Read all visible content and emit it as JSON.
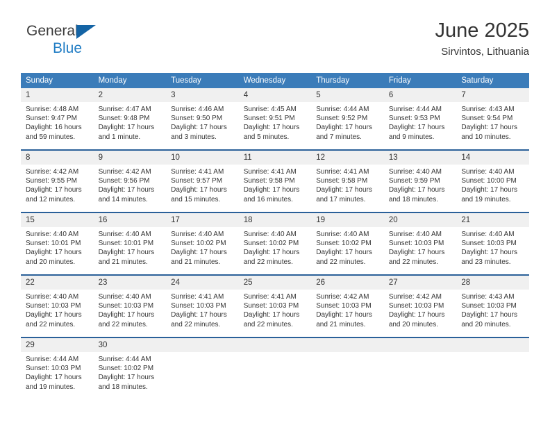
{
  "brand": {
    "name_top": "General",
    "name_bottom": "Blue",
    "triangle_color": "#1464a5",
    "blue_text_color": "#1f7cc4"
  },
  "header": {
    "title": "June 2025",
    "subtitle": "Sirvintos, Lithuania"
  },
  "theme": {
    "header_bg": "#3b7cb9",
    "week_divider": "#2a6099",
    "daynum_bg": "#f0f0f0",
    "text": "#333333"
  },
  "weekdays": [
    "Sunday",
    "Monday",
    "Tuesday",
    "Wednesday",
    "Thursday",
    "Friday",
    "Saturday"
  ],
  "weeks": [
    {
      "days": [
        {
          "num": "1",
          "sunrise": "Sunrise: 4:48 AM",
          "sunset": "Sunset: 9:47 PM",
          "daylight_1": "Daylight: 16 hours",
          "daylight_2": "and 59 minutes."
        },
        {
          "num": "2",
          "sunrise": "Sunrise: 4:47 AM",
          "sunset": "Sunset: 9:48 PM",
          "daylight_1": "Daylight: 17 hours",
          "daylight_2": "and 1 minute."
        },
        {
          "num": "3",
          "sunrise": "Sunrise: 4:46 AM",
          "sunset": "Sunset: 9:50 PM",
          "daylight_1": "Daylight: 17 hours",
          "daylight_2": "and 3 minutes."
        },
        {
          "num": "4",
          "sunrise": "Sunrise: 4:45 AM",
          "sunset": "Sunset: 9:51 PM",
          "daylight_1": "Daylight: 17 hours",
          "daylight_2": "and 5 minutes."
        },
        {
          "num": "5",
          "sunrise": "Sunrise: 4:44 AM",
          "sunset": "Sunset: 9:52 PM",
          "daylight_1": "Daylight: 17 hours",
          "daylight_2": "and 7 minutes."
        },
        {
          "num": "6",
          "sunrise": "Sunrise: 4:44 AM",
          "sunset": "Sunset: 9:53 PM",
          "daylight_1": "Daylight: 17 hours",
          "daylight_2": "and 9 minutes."
        },
        {
          "num": "7",
          "sunrise": "Sunrise: 4:43 AM",
          "sunset": "Sunset: 9:54 PM",
          "daylight_1": "Daylight: 17 hours",
          "daylight_2": "and 10 minutes."
        }
      ]
    },
    {
      "days": [
        {
          "num": "8",
          "sunrise": "Sunrise: 4:42 AM",
          "sunset": "Sunset: 9:55 PM",
          "daylight_1": "Daylight: 17 hours",
          "daylight_2": "and 12 minutes."
        },
        {
          "num": "9",
          "sunrise": "Sunrise: 4:42 AM",
          "sunset": "Sunset: 9:56 PM",
          "daylight_1": "Daylight: 17 hours",
          "daylight_2": "and 14 minutes."
        },
        {
          "num": "10",
          "sunrise": "Sunrise: 4:41 AM",
          "sunset": "Sunset: 9:57 PM",
          "daylight_1": "Daylight: 17 hours",
          "daylight_2": "and 15 minutes."
        },
        {
          "num": "11",
          "sunrise": "Sunrise: 4:41 AM",
          "sunset": "Sunset: 9:58 PM",
          "daylight_1": "Daylight: 17 hours",
          "daylight_2": "and 16 minutes."
        },
        {
          "num": "12",
          "sunrise": "Sunrise: 4:41 AM",
          "sunset": "Sunset: 9:58 PM",
          "daylight_1": "Daylight: 17 hours",
          "daylight_2": "and 17 minutes."
        },
        {
          "num": "13",
          "sunrise": "Sunrise: 4:40 AM",
          "sunset": "Sunset: 9:59 PM",
          "daylight_1": "Daylight: 17 hours",
          "daylight_2": "and 18 minutes."
        },
        {
          "num": "14",
          "sunrise": "Sunrise: 4:40 AM",
          "sunset": "Sunset: 10:00 PM",
          "daylight_1": "Daylight: 17 hours",
          "daylight_2": "and 19 minutes."
        }
      ]
    },
    {
      "days": [
        {
          "num": "15",
          "sunrise": "Sunrise: 4:40 AM",
          "sunset": "Sunset: 10:01 PM",
          "daylight_1": "Daylight: 17 hours",
          "daylight_2": "and 20 minutes."
        },
        {
          "num": "16",
          "sunrise": "Sunrise: 4:40 AM",
          "sunset": "Sunset: 10:01 PM",
          "daylight_1": "Daylight: 17 hours",
          "daylight_2": "and 21 minutes."
        },
        {
          "num": "17",
          "sunrise": "Sunrise: 4:40 AM",
          "sunset": "Sunset: 10:02 PM",
          "daylight_1": "Daylight: 17 hours",
          "daylight_2": "and 21 minutes."
        },
        {
          "num": "18",
          "sunrise": "Sunrise: 4:40 AM",
          "sunset": "Sunset: 10:02 PM",
          "daylight_1": "Daylight: 17 hours",
          "daylight_2": "and 22 minutes."
        },
        {
          "num": "19",
          "sunrise": "Sunrise: 4:40 AM",
          "sunset": "Sunset: 10:02 PM",
          "daylight_1": "Daylight: 17 hours",
          "daylight_2": "and 22 minutes."
        },
        {
          "num": "20",
          "sunrise": "Sunrise: 4:40 AM",
          "sunset": "Sunset: 10:03 PM",
          "daylight_1": "Daylight: 17 hours",
          "daylight_2": "and 22 minutes."
        },
        {
          "num": "21",
          "sunrise": "Sunrise: 4:40 AM",
          "sunset": "Sunset: 10:03 PM",
          "daylight_1": "Daylight: 17 hours",
          "daylight_2": "and 23 minutes."
        }
      ]
    },
    {
      "days": [
        {
          "num": "22",
          "sunrise": "Sunrise: 4:40 AM",
          "sunset": "Sunset: 10:03 PM",
          "daylight_1": "Daylight: 17 hours",
          "daylight_2": "and 22 minutes."
        },
        {
          "num": "23",
          "sunrise": "Sunrise: 4:40 AM",
          "sunset": "Sunset: 10:03 PM",
          "daylight_1": "Daylight: 17 hours",
          "daylight_2": "and 22 minutes."
        },
        {
          "num": "24",
          "sunrise": "Sunrise: 4:41 AM",
          "sunset": "Sunset: 10:03 PM",
          "daylight_1": "Daylight: 17 hours",
          "daylight_2": "and 22 minutes."
        },
        {
          "num": "25",
          "sunrise": "Sunrise: 4:41 AM",
          "sunset": "Sunset: 10:03 PM",
          "daylight_1": "Daylight: 17 hours",
          "daylight_2": "and 22 minutes."
        },
        {
          "num": "26",
          "sunrise": "Sunrise: 4:42 AM",
          "sunset": "Sunset: 10:03 PM",
          "daylight_1": "Daylight: 17 hours",
          "daylight_2": "and 21 minutes."
        },
        {
          "num": "27",
          "sunrise": "Sunrise: 4:42 AM",
          "sunset": "Sunset: 10:03 PM",
          "daylight_1": "Daylight: 17 hours",
          "daylight_2": "and 20 minutes."
        },
        {
          "num": "28",
          "sunrise": "Sunrise: 4:43 AM",
          "sunset": "Sunset: 10:03 PM",
          "daylight_1": "Daylight: 17 hours",
          "daylight_2": "and 20 minutes."
        }
      ]
    },
    {
      "days": [
        {
          "num": "29",
          "sunrise": "Sunrise: 4:44 AM",
          "sunset": "Sunset: 10:03 PM",
          "daylight_1": "Daylight: 17 hours",
          "daylight_2": "and 19 minutes."
        },
        {
          "num": "30",
          "sunrise": "Sunrise: 4:44 AM",
          "sunset": "Sunset: 10:02 PM",
          "daylight_1": "Daylight: 17 hours",
          "daylight_2": "and 18 minutes."
        },
        {
          "num": "",
          "sunrise": "",
          "sunset": "",
          "daylight_1": "",
          "daylight_2": ""
        },
        {
          "num": "",
          "sunrise": "",
          "sunset": "",
          "daylight_1": "",
          "daylight_2": ""
        },
        {
          "num": "",
          "sunrise": "",
          "sunset": "",
          "daylight_1": "",
          "daylight_2": ""
        },
        {
          "num": "",
          "sunrise": "",
          "sunset": "",
          "daylight_1": "",
          "daylight_2": ""
        },
        {
          "num": "",
          "sunrise": "",
          "sunset": "",
          "daylight_1": "",
          "daylight_2": ""
        }
      ]
    }
  ]
}
